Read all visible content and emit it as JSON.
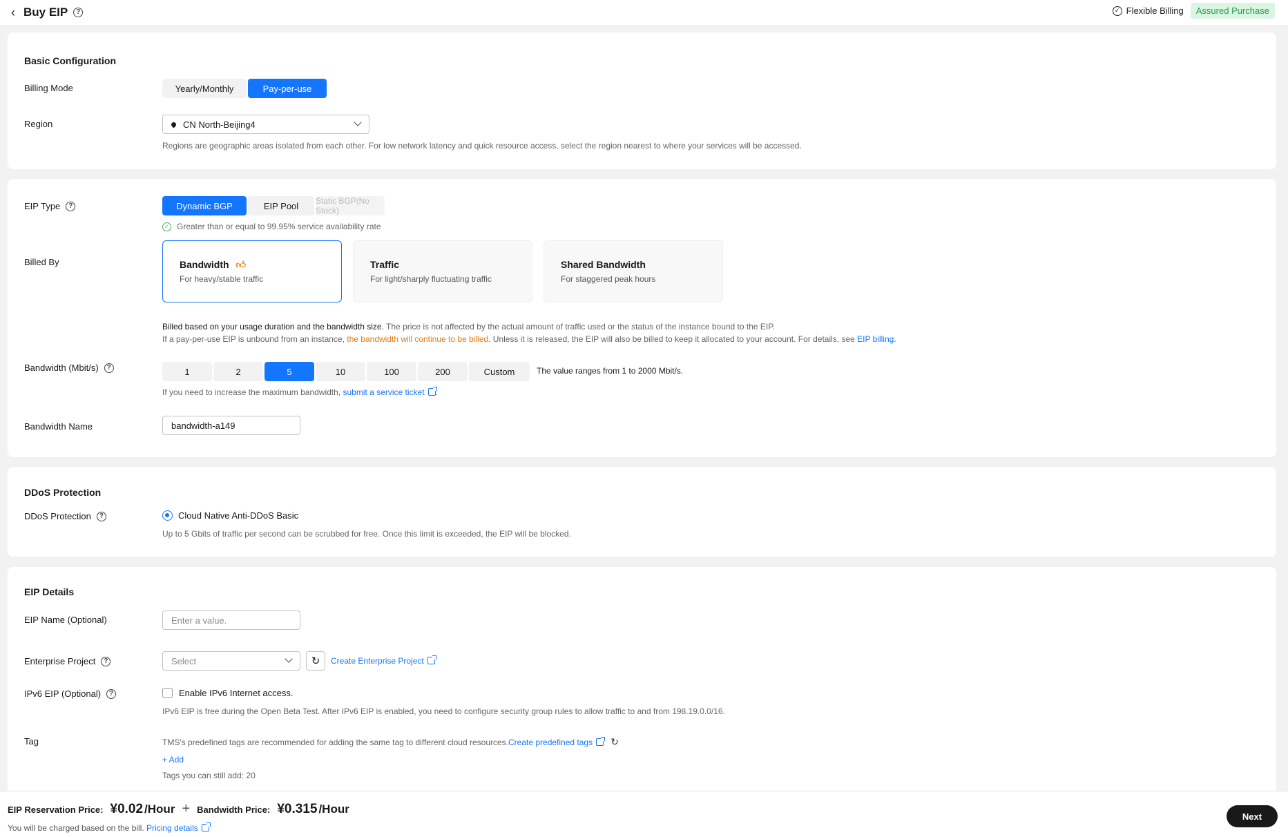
{
  "header": {
    "title": "Buy EIP",
    "flexible_billing": "Flexible Billing",
    "assured_purchase": "Assured Purchase"
  },
  "basic": {
    "section_title": "Basic Configuration",
    "billing_mode_label": "Billing Mode",
    "billing_modes": [
      "Yearly/Monthly",
      "Pay-per-use"
    ],
    "billing_mode_selected": "Pay-per-use",
    "region_label": "Region",
    "region_value": "CN North-Beijing4",
    "region_desc": "Regions are geographic areas isolated from each other. For low network latency and quick resource access, select the region nearest to where your services will be accessed."
  },
  "eip": {
    "type_label": "EIP Type",
    "types": [
      "Dynamic BGP",
      "EIP Pool",
      "Static BGP(No Stock)"
    ],
    "type_selected": "Dynamic BGP",
    "availability": "Greater than or equal to 99.95% service availability rate",
    "billed_by_label": "Billed By",
    "billed_by_options": [
      {
        "title": "Bandwidth",
        "desc": "For heavy/stable traffic"
      },
      {
        "title": "Traffic",
        "desc": "For light/sharply fluctuating traffic"
      },
      {
        "title": "Shared Bandwidth",
        "desc": "For staggered peak hours"
      }
    ],
    "billed_by_selected": "Bandwidth",
    "billed_note_bold": "Billed based on your usage duration and the bandwidth size.",
    "billed_note_rest": " The price is not affected by the actual amount of traffic used or the status of the instance bound to the EIP.",
    "unbound_note_1": "If a pay-per-use EIP is unbound from an instance, ",
    "unbound_note_orange": "the bandwidth will continue to be billed",
    "unbound_note_2": ". Unless it is released, the EIP will also be billed to keep it allocated to your account. For details, see ",
    "eip_billing_link": "EIP billing",
    "unbound_note_end": ".",
    "bandwidth_label": "Bandwidth (Mbit/s)",
    "bandwidth_options": [
      "1",
      "2",
      "5",
      "10",
      "100",
      "200",
      "Custom"
    ],
    "bandwidth_selected": "5",
    "bandwidth_range": "The value ranges from 1 to 2000 Mbit/s.",
    "bandwidth_increase": "If you need to increase the maximum bandwidth, ",
    "service_ticket_link": "submit a service ticket",
    "bandwidth_increase_end": ".",
    "bandwidth_name_label": "Bandwidth Name",
    "bandwidth_name_value": "bandwidth-a149"
  },
  "ddos": {
    "section_title": "DDoS Protection",
    "label": "DDoS Protection",
    "option": "Cloud Native Anti-DDoS Basic",
    "desc": "Up to 5 Gbits of traffic per second can be scrubbed for free. Once this limit is exceeded, the EIP will be blocked."
  },
  "details": {
    "section_title": "EIP Details",
    "name_label": "EIP Name (Optional)",
    "name_placeholder": "Enter a value.",
    "ep_label": "Enterprise Project",
    "ep_placeholder": "Select",
    "ep_create_link": "Create Enterprise Project",
    "ipv6_label": "IPv6 EIP (Optional)",
    "ipv6_checkbox": "Enable IPv6 Internet access.",
    "ipv6_desc": "IPv6 EIP is free during the Open Beta Test. After IPv6 EIP is enabled, you need to configure security group rules to allow traffic to and from 198.19.0.0/16.",
    "tag_label": "Tag",
    "tag_desc": "TMS's predefined tags are recommended for adding the same tag to different cloud resources. ",
    "tag_create_link": "Create predefined tags",
    "tag_add": "+ Add",
    "tag_remaining": "Tags you can still add: 20"
  },
  "footer": {
    "reservation_label": "EIP Reservation Price:",
    "reservation_price": "¥0.02",
    "reservation_unit": "/Hour",
    "bandwidth_label": "Bandwidth Price:",
    "bandwidth_price": "¥0.315",
    "bandwidth_unit": "/Hour",
    "note": "You will be charged based on the bill. ",
    "pricing_link": "Pricing details",
    "next": "Next"
  },
  "colors": {
    "primary": "#1476ff",
    "success": "#3fb35f",
    "warning": "#e57b12",
    "assured_bg": "#dcf5e3"
  }
}
